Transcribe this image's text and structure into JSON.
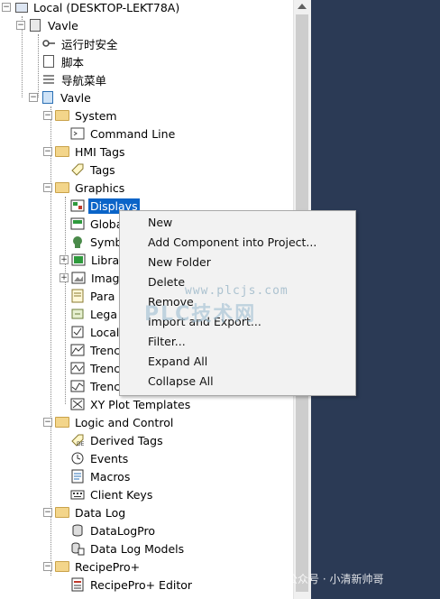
{
  "tree": {
    "root": "Local (DESKTOP-LEKT78A)",
    "vavle_app": "Vavle",
    "runtime_security": "运行时安全",
    "scripts": "脚本",
    "nav_menu": "导航菜单",
    "vavle_proj": "Vavle",
    "system": "System",
    "command_line": "Command Line",
    "hmi_tags": "HMI Tags",
    "tags": "Tags",
    "graphics": "Graphics",
    "displays": "Displays",
    "global": "Globa",
    "symbol": "Symb",
    "library": "Libra",
    "images": "Imag",
    "parameters": "Para",
    "legacy": "Lega",
    "local": "Local",
    "trend1": "Trenc",
    "trend2": "Trenc",
    "trend3": "Trenc",
    "xy_plot": "XY Plot Templates",
    "logic_control": "Logic and Control",
    "derived_tags": "Derived Tags",
    "events": "Events",
    "macros": "Macros",
    "client_keys": "Client Keys",
    "data_log": "Data Log",
    "datalogpro": "DataLogPro",
    "data_log_models": "Data Log Models",
    "recipepro": "RecipePro+",
    "recipepro_editor": "RecipePro+ Editor"
  },
  "context_menu": {
    "new": "New",
    "add_component": "Add Component into Project...",
    "new_folder": "New Folder",
    "delete": "Delete",
    "remove": "Remove",
    "import_export": "Import and Export...",
    "filter": "Filter...",
    "expand_all": "Expand All",
    "collapse_all": "Collapse All"
  },
  "watermarks": {
    "site": "www.plcjs.com",
    "brand": "PLC技术网",
    "account": "公众号 · 小清新帅哥"
  },
  "colors": {
    "selection": "#0a64c8",
    "right_pane": "#2b3a55",
    "menu_bg": "#f2f2f2"
  }
}
